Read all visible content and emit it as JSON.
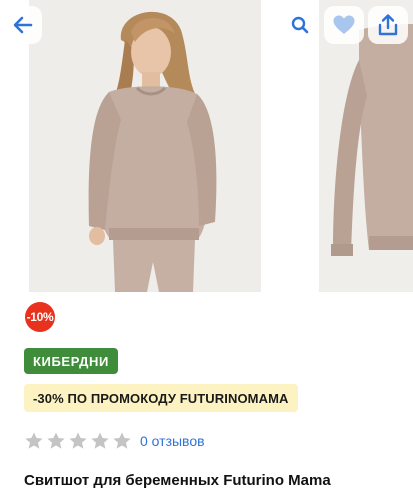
{
  "header": {
    "back_icon": "arrow-left-icon",
    "search_icon": "search-icon",
    "favorite_icon": "heart-icon",
    "share_icon": "share-icon",
    "accent_color": "#2e73d8"
  },
  "gallery": {
    "images": [
      {
        "subject": "product-photo-model-front"
      },
      {
        "subject": "product-photo-detail"
      }
    ]
  },
  "product": {
    "discount_badge": "-10%",
    "promo_tag": "КИБЕРДНИ",
    "coupon_text": "-30% ПО ПРОМОКОДУ FUTURINOMAMA",
    "rating": {
      "stars_filled": 0,
      "stars_total": 5,
      "reviews_text": "0 отзывов"
    },
    "title": "Свитшот для беременных Futurino Mama"
  },
  "colors": {
    "discount_red": "#e8321e",
    "promo_green": "#3f8d3a",
    "coupon_yellow": "#fdf3c2",
    "star_gray": "#c4c4c4"
  }
}
